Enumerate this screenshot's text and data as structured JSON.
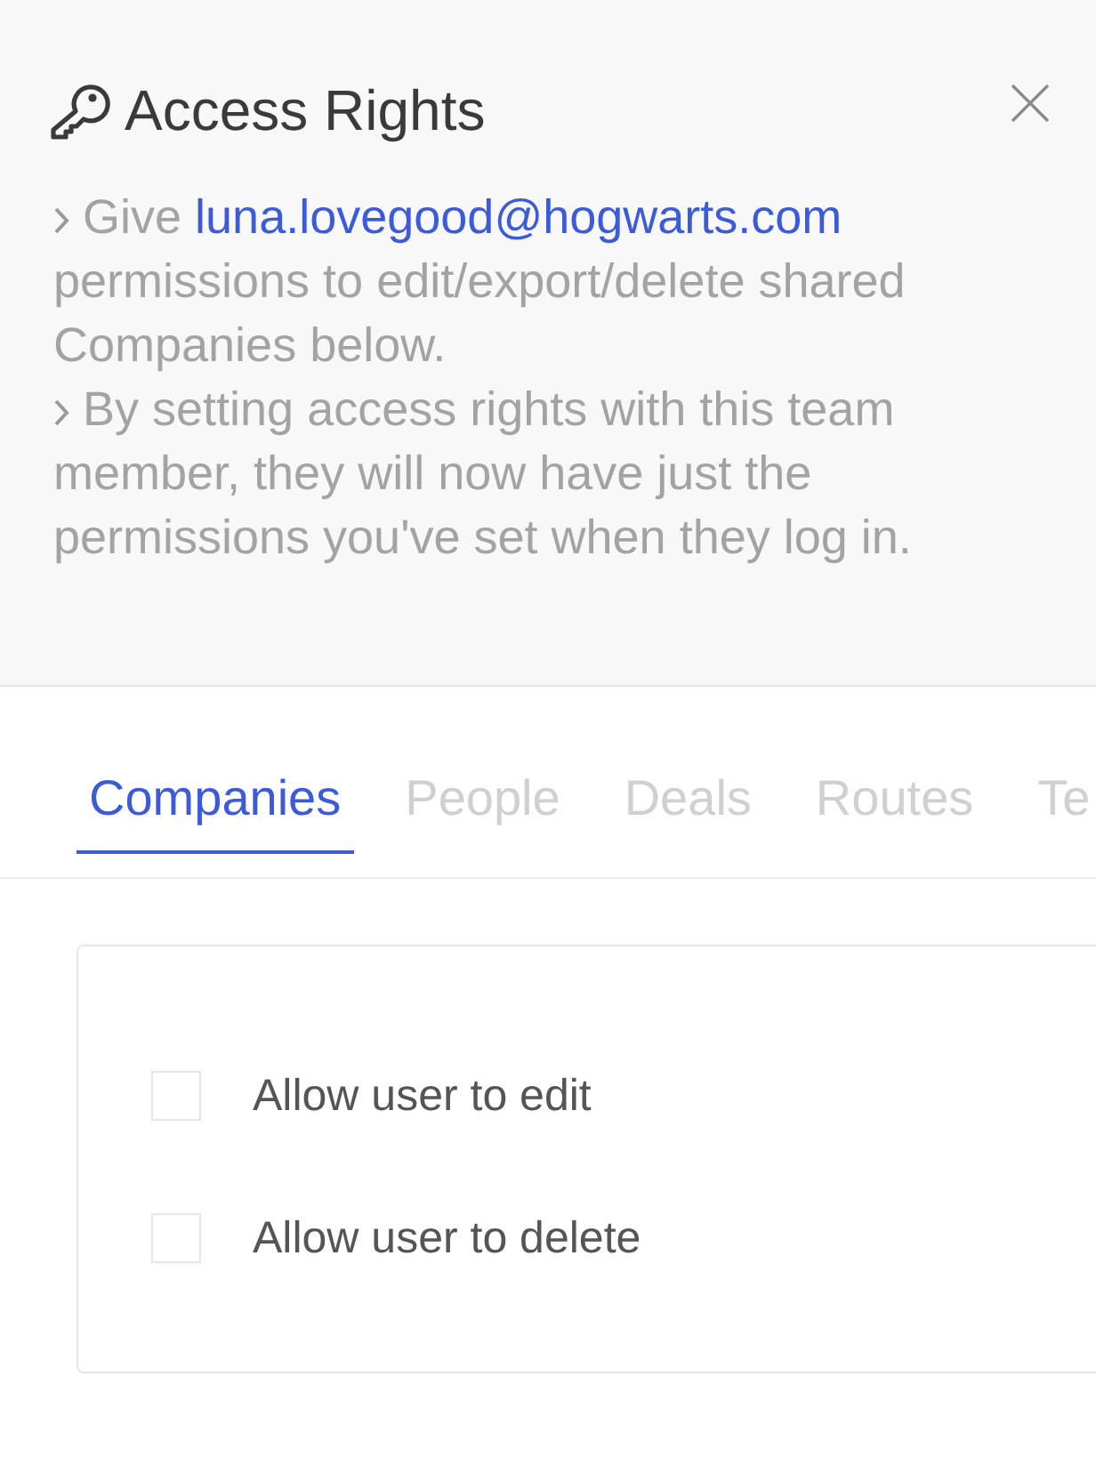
{
  "header": {
    "title": "Access Rights",
    "notes": [
      {
        "text": "Give",
        "link": "luna.lovegood@hogwarts.com",
        "after": "permissions to edit/export/delete shared Companies below."
      },
      {
        "text": "By setting access rights with this team member, they will now have just the permissions you've set when they log in."
      }
    ]
  },
  "tabs": [
    {
      "label": "Companies",
      "selected": true
    },
    {
      "label": "People",
      "selected": false
    },
    {
      "label": "Deals",
      "selected": false
    },
    {
      "label": "Routes",
      "selected": false
    },
    {
      "label": "Te",
      "selected": false
    }
  ],
  "permissions": [
    {
      "label": "Allow user to edit",
      "checked": false
    },
    {
      "label": "Allow user to delete",
      "checked": false
    }
  ]
}
